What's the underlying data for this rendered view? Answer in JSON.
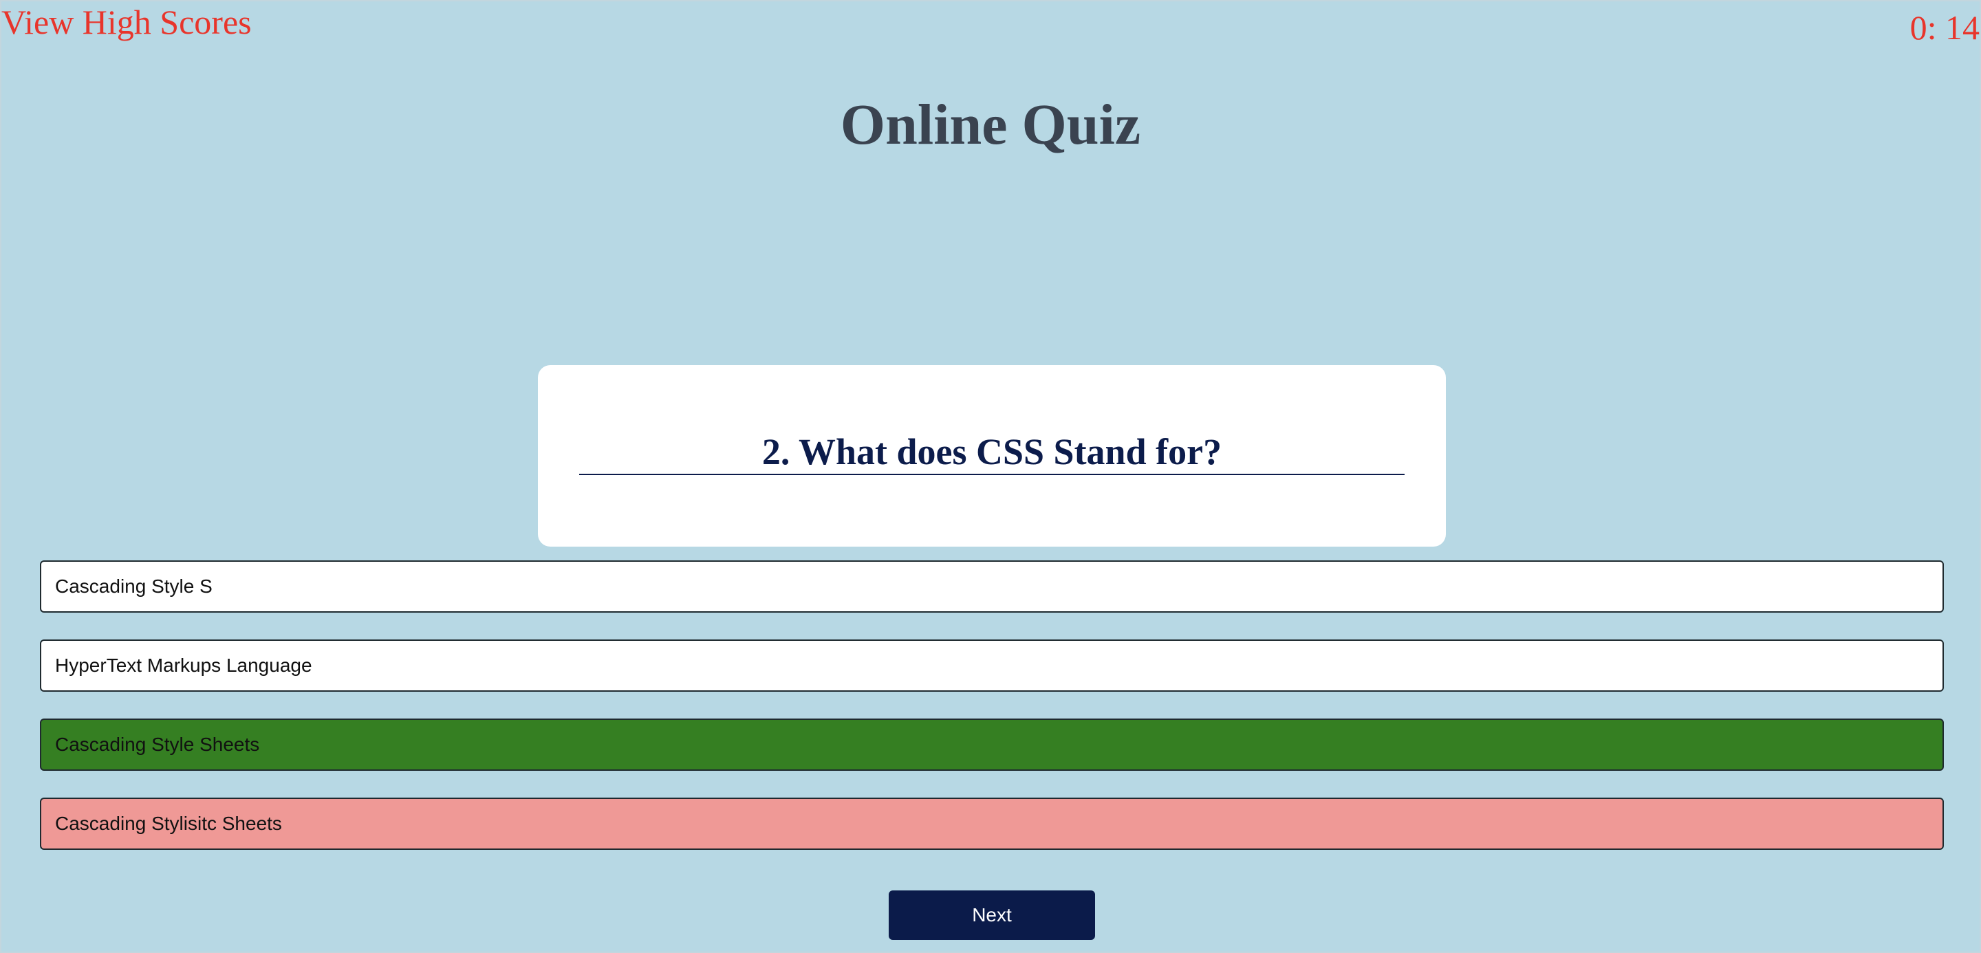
{
  "header": {
    "high_scores_label": "View High Scores",
    "timer_text": "0: 14",
    "title": "Online Quiz"
  },
  "question": {
    "text": "2. What does CSS Stand for?"
  },
  "answers": [
    {
      "label": "Cascading Style S",
      "state": "neutral"
    },
    {
      "label": "HyperText Markups Language",
      "state": "neutral"
    },
    {
      "label": "Cascading Style Sheets",
      "state": "correct"
    },
    {
      "label": "Cascading Stylisitc Sheets",
      "state": "wrong"
    }
  ],
  "controls": {
    "next_label": "Next"
  },
  "colors": {
    "background": "#b7d8e4",
    "accent_red": "#e8352b",
    "title": "#3a4350",
    "question": "#0c1c4b",
    "correct": "#357f22",
    "wrong": "#ef9996",
    "button": "#0b1b4a"
  }
}
